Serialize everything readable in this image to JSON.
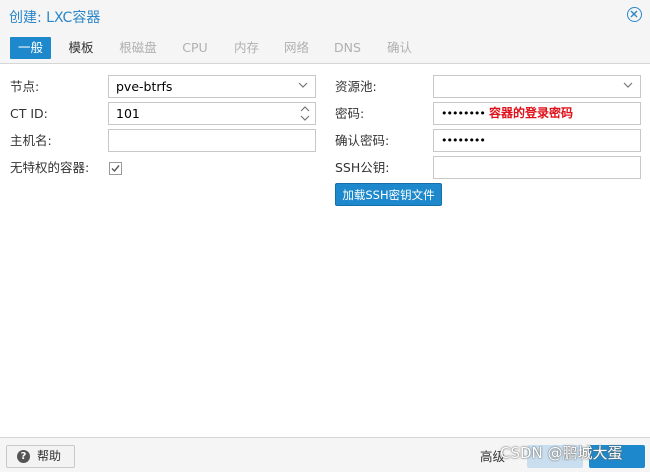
{
  "window": {
    "title": "创建: LXC容器"
  },
  "tabs": [
    {
      "label": "一般",
      "state": "active"
    },
    {
      "label": "模板",
      "state": "enabled"
    },
    {
      "label": "根磁盘",
      "state": "disabled"
    },
    {
      "label": "CPU",
      "state": "disabled"
    },
    {
      "label": "内存",
      "state": "disabled"
    },
    {
      "label": "网络",
      "state": "disabled"
    },
    {
      "label": "DNS",
      "state": "disabled"
    },
    {
      "label": "确认",
      "state": "disabled"
    }
  ],
  "form": {
    "node": {
      "label": "节点:",
      "value": "pve-btrfs"
    },
    "ctid": {
      "label": "CT ID:",
      "value": "101"
    },
    "hostname": {
      "label": "主机名:",
      "value": ""
    },
    "unprivileged": {
      "label": "无特权的容器:",
      "checked": true
    },
    "pool": {
      "label": "资源池:",
      "value": ""
    },
    "password": {
      "label": "密码:",
      "value": "••••••••",
      "annotation": "容器的登录密码"
    },
    "confirm_password": {
      "label": "确认密码:",
      "value": "••••••••"
    },
    "ssh_key": {
      "label": "SSH公钥:",
      "value": ""
    },
    "load_ssh_button": "加载SSH密钥文件"
  },
  "footer": {
    "help_label": "帮助",
    "advanced_label": "高级",
    "watermark": "CSDN @鹏城大蛋"
  },
  "colors": {
    "accent": "#1d88cb",
    "annotation": "#e0111a",
    "title": "#2a86c8"
  }
}
